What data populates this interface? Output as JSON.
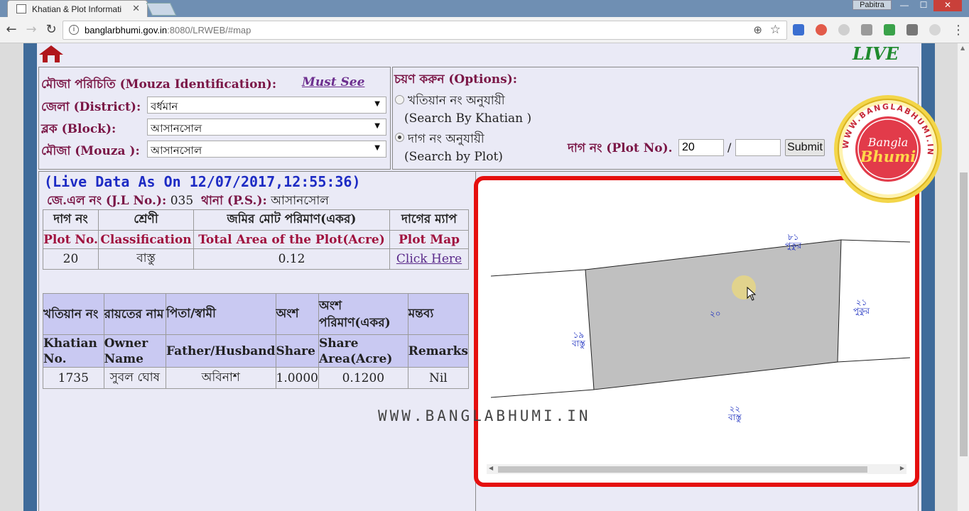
{
  "browser": {
    "tab_title": "Khatian & Plot Informati",
    "url_host": "banglarbhumi.gov.in",
    "url_rest": ":8080/LRWEB/#map",
    "user": "Pabitra",
    "icons": [
      "back-icon",
      "forward-icon",
      "reload-icon",
      "info-icon",
      "zoom-icon",
      "star-icon",
      "menu-icon"
    ]
  },
  "header": {
    "live": "LIVE"
  },
  "mouza": {
    "title": "মৌজা পরিচিতি (Mouza Identification):",
    "must_see": "Must See",
    "district_label": "জেলা (District):",
    "district_value": "বর্ধমান",
    "block_label": "ব্লক (Block):",
    "block_value": "আসানসোল",
    "mouza_label": "মৌজা (Mouza ):",
    "mouza_value": "আসানসোল"
  },
  "options": {
    "title": "চয়ণ করুন (Options):",
    "khatian_bn": "খতিয়ান নং অনুযায়ী",
    "khatian_en": "(Search By Khatian )",
    "plot_bn": "দাগ নং অনুযায়ী",
    "plot_en": "(Search by Plot)",
    "plot_label": "দাগ নং (Plot No).",
    "plot_value": "20",
    "slash": "/",
    "plot_value2": "",
    "submit": "Submit"
  },
  "live_data": {
    "title": "(Live Data As On 12/07/2017,12:55:36)",
    "jl_label": "জে.এল নং (J.L No.):",
    "jl_value": "035",
    "ps_label": "থানা (P.S.):",
    "ps_value": "আসানসোল"
  },
  "plot_table": {
    "headers_bn": [
      "দাগ নং",
      "শ্রেণী",
      "জমির মোট পরিমাণ(একর)",
      "দাগের ম্যাপ"
    ],
    "headers_en": [
      "Plot No.",
      "Classification",
      "Total Area of the Plot(Acre)",
      "Plot Map"
    ],
    "row": [
      "20",
      "বাস্তু",
      "0.12",
      "Click Here"
    ]
  },
  "owner_table": {
    "headers_bn": [
      "খতিয়ান নং",
      "রায়তের নাম",
      "পিতা/স্বামী",
      "অংশ",
      "অংশ পরিমাণ(একর)",
      "মন্তব্য"
    ],
    "headers_en": [
      "Khatian No.",
      "Owner Name",
      "Father/Husband",
      "Share",
      "Share Area(Acre)",
      "Remarks"
    ],
    "row": [
      "1735",
      "সুবল ঘোষ",
      "অবিনাশ",
      "1.0000",
      "0.1200",
      "Nil"
    ]
  },
  "watermark": "WWW.BANGLABHUMI.IN",
  "map": {
    "labels": {
      "p81": "৮১",
      "p81_type": "পুকুর",
      "p20": "২০",
      "p21": "২১",
      "p21_type": "পুকুর",
      "p19": "১৯",
      "p19_type": "বাস্তু",
      "p22": "২২",
      "p22_type": "বাস্তু"
    }
  },
  "seal": {
    "ring_text": "WWW.BANGLABHUMI.IN",
    "line1": "Bangla",
    "line2": "Bhumi"
  }
}
